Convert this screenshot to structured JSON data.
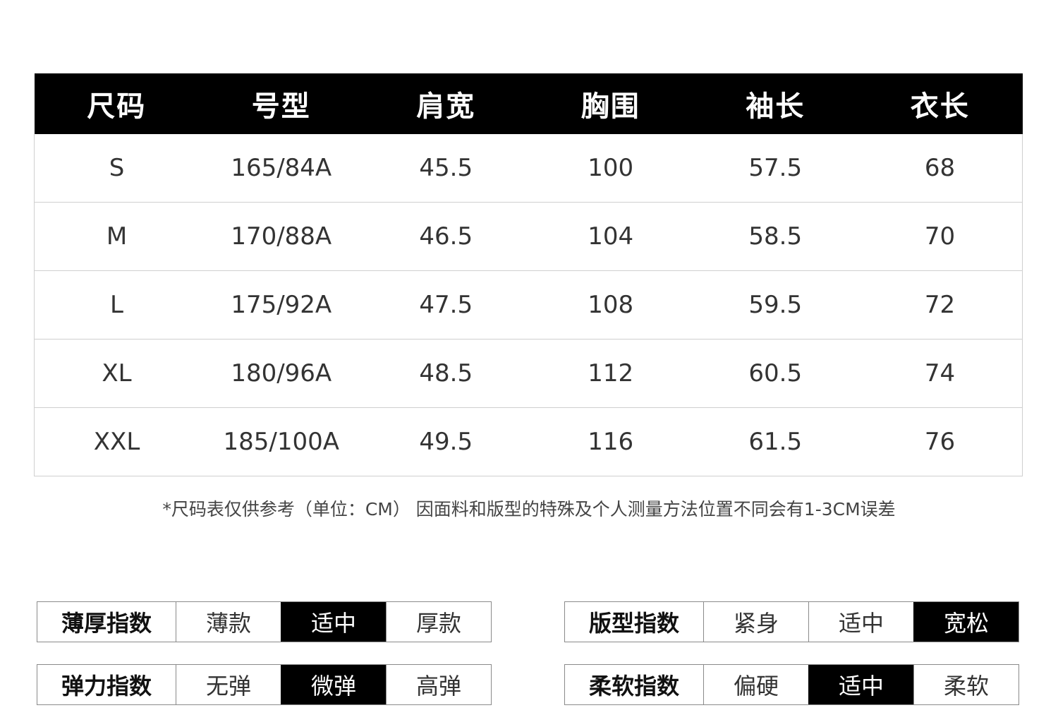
{
  "size_table": {
    "headers": [
      "尺码",
      "号型",
      "肩宽",
      "胸围",
      "袖长",
      "衣长"
    ],
    "rows": [
      [
        "S",
        "165/84A",
        "45.5",
        "100",
        "57.5",
        "68"
      ],
      [
        "M",
        "170/88A",
        "46.5",
        "104",
        "58.5",
        "70"
      ],
      [
        "L",
        "175/92A",
        "47.5",
        "108",
        "59.5",
        "72"
      ],
      [
        "XL",
        "180/96A",
        "48.5",
        "112",
        "60.5",
        "74"
      ],
      [
        "XXL",
        "185/100A",
        "49.5",
        "116",
        "61.5",
        "76"
      ]
    ]
  },
  "note": "*尺码表仅供参考（单位：CM）  因面料和版型的特殊及个人测量方法位置不同会有1-3CM误差",
  "indices": {
    "thickness": {
      "label": "薄厚指数",
      "options": [
        "薄款",
        "适中",
        "厚款"
      ],
      "selected": "适中"
    },
    "fit": {
      "label": "版型指数",
      "options": [
        "紧身",
        "适中",
        "宽松"
      ],
      "selected": "宽松"
    },
    "elasticity": {
      "label": "弹力指数",
      "options": [
        "无弹",
        "微弹",
        "高弹"
      ],
      "selected": "微弹"
    },
    "softness": {
      "label": "柔软指数",
      "options": [
        "偏硬",
        "适中",
        "柔软"
      ],
      "selected": "适中"
    }
  },
  "colors": {
    "header_bg": "#000000",
    "header_text": "#ffffff",
    "selected_bg": "#000000",
    "selected_text": "#ffffff",
    "border": "#cfcfcf"
  }
}
